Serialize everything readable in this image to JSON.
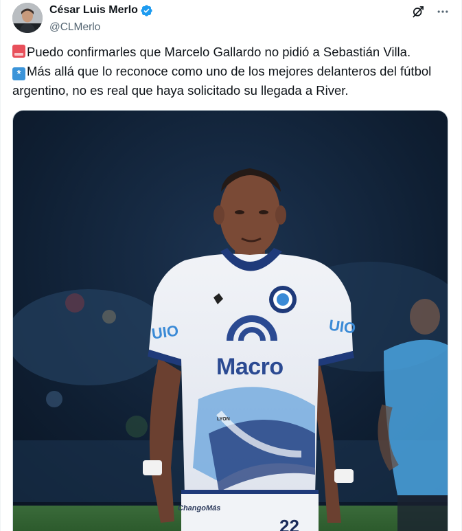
{
  "tweet": {
    "author": {
      "display_name": "César Luis Merlo",
      "handle": "@CLMerlo",
      "verified": true,
      "avatar_icon": "avatar-photo"
    },
    "actions": {
      "grok_icon": "grok-icon",
      "more_icon": "more-options-icon"
    },
    "text": {
      "line1_emoji": "rotating-light-emoji",
      "line1": "Puedo confirmarles que Marcelo Gallardo no pidió a Sebastián Villa.",
      "line2_emoji": "asterisk-emoji",
      "line2": "Más allá que lo reconoce como uno de los mejores delanteros del fútbol argentino, no es real que haya solicitado su llegada a River."
    },
    "media": {
      "description_icon": "player-photo",
      "jersey_sponsor": "Macro",
      "jersey_brand": "LYON",
      "sleeve_text": "UIO",
      "shorts_text": "ChangoMás",
      "shorts_number": "22"
    }
  },
  "colors": {
    "verified_badge": "#1d9bf0",
    "handle": "#536471",
    "text": "#0f1419",
    "jersey_navy": "#1f3a7a",
    "jersey_blue": "#3a8ad6"
  }
}
